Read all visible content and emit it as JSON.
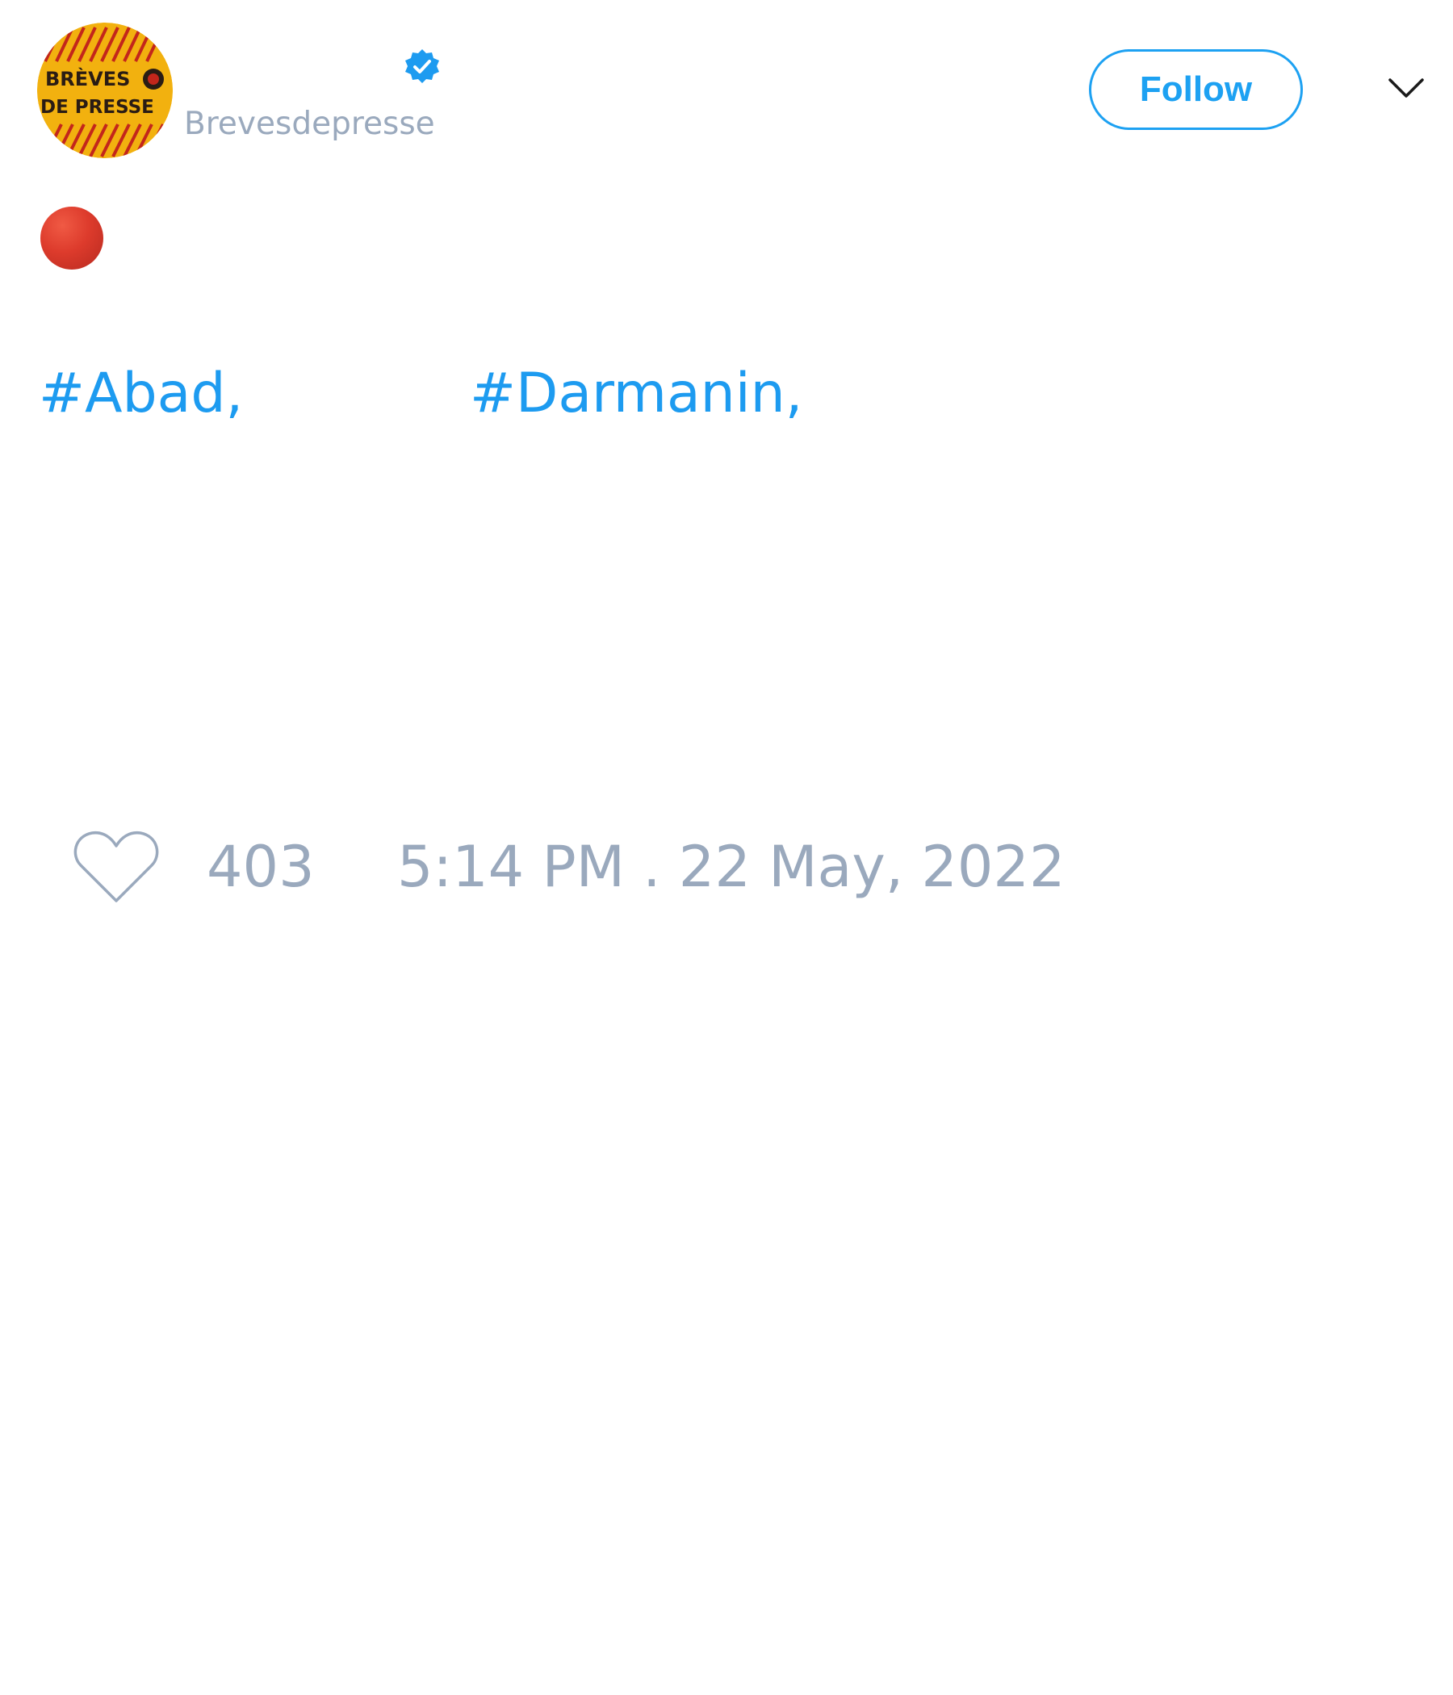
{
  "author": {
    "avatar_text_line1": "BRÈVES",
    "avatar_text_line2": "DE PRESSE",
    "handle": "Brevesdepresse",
    "verified": true
  },
  "header": {
    "follow_label": "Follow",
    "menu_icon": "chevron-down-icon"
  },
  "tweet": {
    "status_emoji": "red-circle",
    "hashtags": [
      "#Abad,",
      "#Darmanin,"
    ]
  },
  "footer": {
    "like_icon": "heart-icon",
    "like_count": "403",
    "timestamp": "5:14 PM . 22 May, 2022"
  },
  "colors": {
    "accent": "#1da1f2",
    "muted_text": "#9aa9bd",
    "status_dot": "#dd3b2c"
  }
}
